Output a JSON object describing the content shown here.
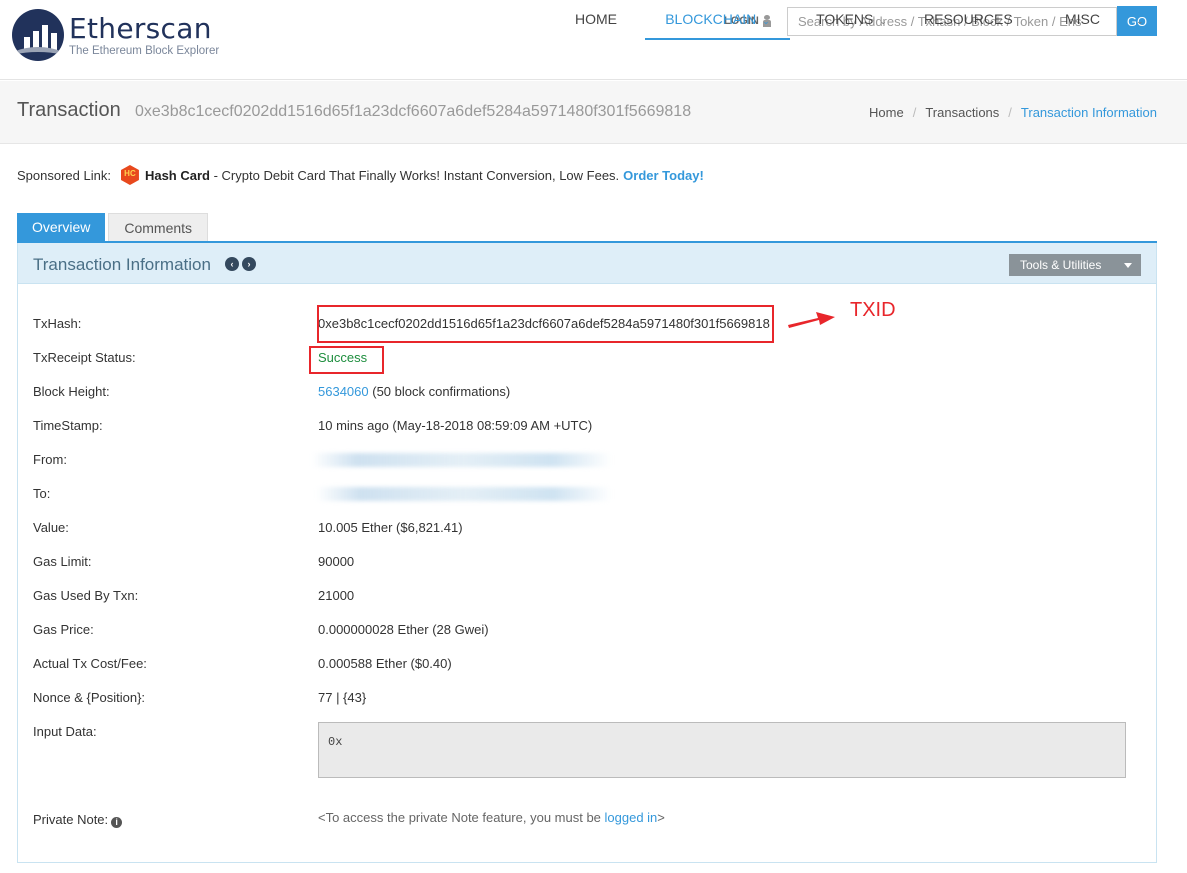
{
  "header": {
    "logo": {
      "name": "Etherscan",
      "tagline": "The Ethereum Block Explorer"
    },
    "login_label": "LOGIN",
    "search_placeholder": "Search by Address / Txhash / Block / Token / Ens",
    "go_label": "GO",
    "nav": [
      {
        "label": "HOME",
        "dropdown": false,
        "active": false
      },
      {
        "label": "BLOCKCHAIN",
        "dropdown": true,
        "active": true
      },
      {
        "label": "TOKENS",
        "dropdown": true,
        "active": false
      },
      {
        "label": "RESOURCES",
        "dropdown": false,
        "active": false
      },
      {
        "label": "MISC",
        "dropdown": true,
        "active": false
      }
    ]
  },
  "titlebar": {
    "title": "Transaction",
    "hash": "0xe3b8c1cecf0202dd1516d65f1a23dcf6607a6def5284a5971480f301f5669818",
    "breadcrumb": [
      "Home",
      "Transactions",
      "Transaction Information"
    ]
  },
  "sponsor": {
    "prefix": "Sponsored Link:",
    "icon_text": "HC",
    "brand": "Hash Card",
    "text": " - Crypto Debit Card That Finally Works! Instant Conversion, Low Fees.",
    "cta": "Order Today!"
  },
  "tabs": [
    "Overview",
    "Comments"
  ],
  "panel": {
    "title": "Transaction Information",
    "tools_label": "Tools & Utilities"
  },
  "details": {
    "txhash_label": "TxHash:",
    "txhash": "0xe3b8c1cecf0202dd1516d65f1a23dcf6607a6def5284a5971480f301f5669818",
    "status_label": "TxReceipt Status:",
    "status": "Success",
    "block_label": "Block Height:",
    "block": "5634060",
    "block_conf": " (50 block confirmations)",
    "timestamp_label": "TimeStamp:",
    "timestamp": "10 mins ago (May-18-2018 08:59:09 AM +UTC)",
    "from_label": "From:",
    "to_label": "To:",
    "value_label": "Value:",
    "value": "10.005 Ether ($6,821.41)",
    "gas_limit_label": "Gas Limit:",
    "gas_limit": "90000",
    "gas_used_label": "Gas Used By Txn:",
    "gas_used": "21000",
    "gas_price_label": "Gas Price:",
    "gas_price": "0.000000028 Ether (28 Gwei)",
    "fee_label": "Actual Tx Cost/Fee:",
    "fee": "0.000588 Ether ($0.40)",
    "nonce_label": "Nonce & {Position}:",
    "nonce": "77 | {43}",
    "input_label": "Input Data:",
    "input": "0x",
    "note_label": "Private Note:",
    "note_prefix": "<To access the private Note feature, you must be ",
    "note_link": "logged in",
    "note_suffix": ">"
  },
  "annotation": {
    "label": "TXID",
    "color": "#e8262b"
  }
}
